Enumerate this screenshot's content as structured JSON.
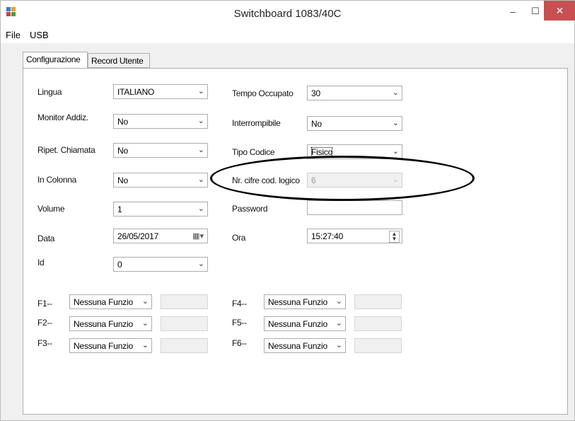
{
  "window": {
    "title": "Switchboard 1083/40C",
    "minimize": "–",
    "maximize": "☐",
    "close": "✕"
  },
  "menu": {
    "file": "File",
    "usb": "USB"
  },
  "tabs": [
    "Configurazione",
    "Record Utente"
  ],
  "left": {
    "lingua": {
      "label": "Lingua",
      "value": "ITALIANO"
    },
    "monitor": {
      "label": "Monitor Addiz.",
      "value": "No"
    },
    "ripet": {
      "label": "Ripet. Chiamata",
      "value": "No"
    },
    "colonna": {
      "label": "In Colonna",
      "value": "No"
    },
    "volume": {
      "label": "Volume",
      "value": "1"
    },
    "data": {
      "label": "Data",
      "value": "26/05/2017"
    },
    "id": {
      "label": "Id",
      "value": "0"
    }
  },
  "right": {
    "tempo": {
      "label": "Tempo Occupato",
      "value": "30"
    },
    "interrompibile": {
      "label": "Interrompibile",
      "value": "No"
    },
    "tipo": {
      "label": "Tipo Codice",
      "value": "Fisico"
    },
    "nrcifre": {
      "label": "Nr. cifre cod. logico",
      "value": "6"
    },
    "password": {
      "label": "Password",
      "value": ""
    },
    "ora": {
      "label": "Ora",
      "value": "15:27:40"
    }
  },
  "fkeys": [
    {
      "label": "F1--",
      "value": "Nessuna Funzio"
    },
    {
      "label": "F2--",
      "value": "Nessuna Funzio"
    },
    {
      "label": "F3--",
      "value": "Nessuna Funzio"
    },
    {
      "label": "F4--",
      "value": "Nessuna Funzio"
    },
    {
      "label": "F5--",
      "value": "Nessuna Funzio"
    },
    {
      "label": "F6--",
      "value": "Nessuna Funzio"
    }
  ],
  "icons": {
    "dropdown": "chevron-down-icon",
    "calendar": "calendar-icon",
    "spinner": "spinner-icon",
    "app": "app-icon"
  }
}
